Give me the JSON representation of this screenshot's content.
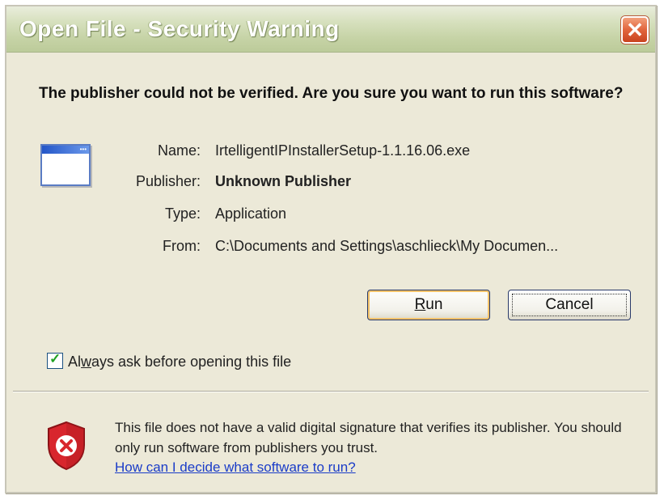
{
  "window": {
    "title": "Open File - Security Warning",
    "close_glyph": "✕"
  },
  "headline": "The publisher could not be verified.  Are you sure you want to run this software?",
  "details": [
    {
      "label": "Name:",
      "value": "IrtelligentIPInstallerSetup-1.1.16.06.exe",
      "bold": false
    },
    {
      "label": "Publisher:",
      "value": "Unknown Publisher",
      "bold": true
    },
    {
      "label": "Type:",
      "value": "Application",
      "bold": false
    },
    {
      "label": "From:",
      "value": "C:\\Documents and Settings\\aschlieck\\My Documen...",
      "bold": false
    }
  ],
  "buttons": {
    "run_label": "Run",
    "run_accelerator": "R",
    "run_rest": "un",
    "cancel_label": "Cancel"
  },
  "checkbox": {
    "checked": true,
    "label_before": "Al",
    "label_accel": "w",
    "label_after": "ays ask before opening this file",
    "full_label": "Always ask before opening this file"
  },
  "footer": {
    "message": "This file does not have a valid digital signature that verifies its publisher.  You should only run software from publishers you trust.",
    "help_link": "How can I decide what software to run?"
  },
  "icons": {
    "app": "application-window-icon",
    "shield": "security-shield-error-icon"
  },
  "colors": {
    "titlebar": "#c6d3a6",
    "dialog_bg": "#ece9d8",
    "close_button": "#e1643c",
    "link": "#1a3cc8",
    "shield_red": "#d8262d"
  }
}
